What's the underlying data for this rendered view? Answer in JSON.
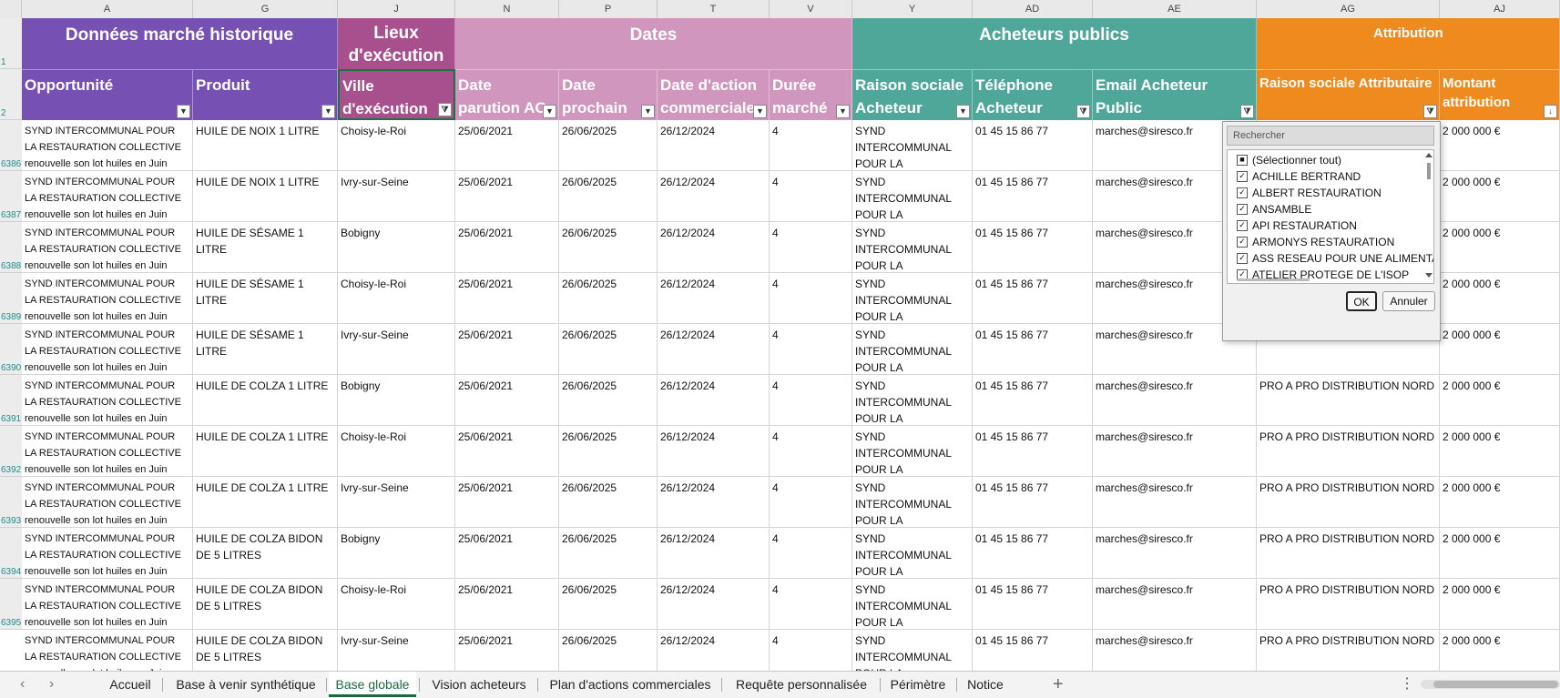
{
  "column_letters": [
    "A",
    "G",
    "J",
    "N",
    "P",
    "T",
    "V",
    "Y",
    "AD",
    "AE",
    "AG",
    "AJ"
  ],
  "row_numbers": [
    "1",
    "2",
    "6386",
    "6387",
    "6388",
    "6389",
    "6390",
    "6391",
    "6392",
    "6393",
    "6394",
    "6395"
  ],
  "groups": {
    "historique": "Données marché historique",
    "lieux": "Lieux d'exécution",
    "dates": "Dates",
    "acheteurs": "Acheteurs publics",
    "attribution": "Attribution"
  },
  "headers": {
    "opportunite": "Opportunité",
    "produit": "Produit",
    "ville": "Ville d'exécution",
    "date_parution": "Date parution AO",
    "date_prochain": "Date prochain AO",
    "date_action": "Date d'action commerciale",
    "duree": "Durée marché",
    "raison_acheteur": "Raison sociale Acheteur",
    "telephone": "Téléphone Acheteur",
    "email": "Email Acheteur Public",
    "raison_attributaire": "Raison sociale Attributaire",
    "montant": "Montant attribution"
  },
  "rows": [
    {
      "opportunite": "SYND INTERCOMMUNAL POUR LA RESTAURATION COLLECTIVE renouvelle son lot huiles en Juin",
      "produit": "HUILE DE NOIX 1 LITRE",
      "ville": "Choisy-le-Roi",
      "parution": "25/06/2021",
      "prochain": "26/06/2025",
      "action": "26/12/2024",
      "duree": "4",
      "acheteur": "SYND INTERCOMMUNAL POUR LA",
      "tel": "01 45 15 86 77",
      "email": "marches@siresco.fr",
      "attributaire": "",
      "montant": "2 000 000 €"
    },
    {
      "opportunite": "SYND INTERCOMMUNAL POUR LA RESTAURATION COLLECTIVE renouvelle son lot huiles en Juin",
      "produit": "HUILE DE NOIX 1 LITRE",
      "ville": "Ivry-sur-Seine",
      "parution": "25/06/2021",
      "prochain": "26/06/2025",
      "action": "26/12/2024",
      "duree": "4",
      "acheteur": "SYND INTERCOMMUNAL POUR LA",
      "tel": "01 45 15 86 77",
      "email": "marches@siresco.fr",
      "attributaire": "",
      "montant": "2 000 000 €"
    },
    {
      "opportunite": "SYND INTERCOMMUNAL POUR LA RESTAURATION COLLECTIVE renouvelle son lot huiles en Juin",
      "produit": "HUILE DE SÉSAME 1 LITRE",
      "ville": "Bobigny",
      "parution": "25/06/2021",
      "prochain": "26/06/2025",
      "action": "26/12/2024",
      "duree": "4",
      "acheteur": "SYND INTERCOMMUNAL POUR LA",
      "tel": "01 45 15 86 77",
      "email": "marches@siresco.fr",
      "attributaire": "",
      "montant": "2 000 000 €"
    },
    {
      "opportunite": "SYND INTERCOMMUNAL POUR LA RESTAURATION COLLECTIVE renouvelle son lot huiles en Juin",
      "produit": "HUILE DE SÉSAME 1 LITRE",
      "ville": "Choisy-le-Roi",
      "parution": "25/06/2021",
      "prochain": "26/06/2025",
      "action": "26/12/2024",
      "duree": "4",
      "acheteur": "SYND INTERCOMMUNAL POUR LA",
      "tel": "01 45 15 86 77",
      "email": "marches@siresco.fr",
      "attributaire": "",
      "montant": "2 000 000 €"
    },
    {
      "opportunite": "SYND INTERCOMMUNAL POUR LA RESTAURATION COLLECTIVE renouvelle son lot huiles en Juin",
      "produit": "HUILE DE SÉSAME 1 LITRE",
      "ville": "Ivry-sur-Seine",
      "parution": "25/06/2021",
      "prochain": "26/06/2025",
      "action": "26/12/2024",
      "duree": "4",
      "acheteur": "SYND INTERCOMMUNAL POUR LA",
      "tel": "01 45 15 86 77",
      "email": "marches@siresco.fr",
      "attributaire": "",
      "montant": "2 000 000 €"
    },
    {
      "opportunite": "SYND INTERCOMMUNAL POUR LA RESTAURATION COLLECTIVE renouvelle son lot huiles en Juin",
      "produit": "HUILE DE COLZA 1 LITRE",
      "ville": "Bobigny",
      "parution": "25/06/2021",
      "prochain": "26/06/2025",
      "action": "26/12/2024",
      "duree": "4",
      "acheteur": "SYND INTERCOMMUNAL POUR LA",
      "tel": "01 45 15 86 77",
      "email": "marches@siresco.fr",
      "attributaire": "PRO A PRO DISTRIBUTION NORD",
      "montant": "2 000 000 €"
    },
    {
      "opportunite": "SYND INTERCOMMUNAL POUR LA RESTAURATION COLLECTIVE renouvelle son lot huiles en Juin",
      "produit": "HUILE DE COLZA 1 LITRE",
      "ville": "Choisy-le-Roi",
      "parution": "25/06/2021",
      "prochain": "26/06/2025",
      "action": "26/12/2024",
      "duree": "4",
      "acheteur": "SYND INTERCOMMUNAL POUR LA",
      "tel": "01 45 15 86 77",
      "email": "marches@siresco.fr",
      "attributaire": "PRO A PRO DISTRIBUTION NORD",
      "montant": "2 000 000 €"
    },
    {
      "opportunite": "SYND INTERCOMMUNAL POUR LA RESTAURATION COLLECTIVE renouvelle son lot huiles en Juin",
      "produit": "HUILE DE COLZA 1 LITRE",
      "ville": "Ivry-sur-Seine",
      "parution": "25/06/2021",
      "prochain": "26/06/2025",
      "action": "26/12/2024",
      "duree": "4",
      "acheteur": "SYND INTERCOMMUNAL POUR LA",
      "tel": "01 45 15 86 77",
      "email": "marches@siresco.fr",
      "attributaire": "PRO A PRO DISTRIBUTION NORD",
      "montant": "2 000 000 €"
    },
    {
      "opportunite": "SYND INTERCOMMUNAL POUR LA RESTAURATION COLLECTIVE renouvelle son lot huiles en Juin",
      "produit": "HUILE DE COLZA BIDON DE 5 LITRES",
      "ville": "Bobigny",
      "parution": "25/06/2021",
      "prochain": "26/06/2025",
      "action": "26/12/2024",
      "duree": "4",
      "acheteur": "SYND INTERCOMMUNAL POUR LA",
      "tel": "01 45 15 86 77",
      "email": "marches@siresco.fr",
      "attributaire": "PRO A PRO DISTRIBUTION NORD",
      "montant": "2 000 000 €"
    },
    {
      "opportunite": "SYND INTERCOMMUNAL POUR LA RESTAURATION COLLECTIVE renouvelle son lot huiles en Juin",
      "produit": "HUILE DE COLZA BIDON DE 5 LITRES",
      "ville": "Choisy-le-Roi",
      "parution": "25/06/2021",
      "prochain": "26/06/2025",
      "action": "26/12/2024",
      "duree": "4",
      "acheteur": "SYND INTERCOMMUNAL POUR LA",
      "tel": "01 45 15 86 77",
      "email": "marches@siresco.fr",
      "attributaire": "PRO A PRO DISTRIBUTION NORD",
      "montant": "2 000 000 €"
    },
    {
      "opportunite": "SYND INTERCOMMUNAL POUR LA RESTAURATION COLLECTIVE renouvelle son lot huiles en Juin",
      "produit": "HUILE DE COLZA BIDON DE 5 LITRES",
      "ville": "Ivry-sur-Seine",
      "parution": "25/06/2021",
      "prochain": "26/06/2025",
      "action": "26/12/2024",
      "duree": "4",
      "acheteur": "SYND INTERCOMMUNAL POUR LA",
      "tel": "01 45 15 86 77",
      "email": "marches@siresco.fr",
      "attributaire": "PRO A PRO DISTRIBUTION NORD",
      "montant": "2 000 000 €"
    }
  ],
  "filter_popup": {
    "search_placeholder": "Rechercher",
    "items": [
      {
        "label": "(Sélectionner tout)",
        "state": "partial"
      },
      {
        "label": "ACHILLE BERTRAND",
        "state": "checked"
      },
      {
        "label": "ALBERT RESTAURATION",
        "state": "checked"
      },
      {
        "label": "ANSAMBLE",
        "state": "checked"
      },
      {
        "label": "API RESTAURATION",
        "state": "checked"
      },
      {
        "label": "ARMONYS RESTAURATION",
        "state": "checked"
      },
      {
        "label": "ASS RESEAU POUR UNE ALIMENTA",
        "state": "checked"
      },
      {
        "label": "ATELIER PROTEGE DE L'ISOP",
        "state": "checked"
      }
    ],
    "ok_label": "OK",
    "cancel_label": "Annuler"
  },
  "tabs": [
    {
      "label": "Accueil",
      "active": false
    },
    {
      "label": "Base à venir synthétique",
      "active": false
    },
    {
      "label": "Base globale",
      "active": true
    },
    {
      "label": "Vision acheteurs",
      "active": false
    },
    {
      "label": "Plan d'actions commerciales",
      "active": false
    },
    {
      "label": "Requête personnalisée",
      "active": false
    },
    {
      "label": "Périmètre",
      "active": false
    },
    {
      "label": "Notice",
      "active": false
    }
  ],
  "icons": {
    "filter_dropdown": "chevron-down-icon",
    "filter_active": "funnel-icon",
    "add_sheet": "plus-icon",
    "prev_sheet": "chevron-left-icon",
    "next_sheet": "chevron-right-icon",
    "more": "vertical-dots-icon"
  },
  "colors": {
    "historique": "#7651b3",
    "lieux": "#a8508d",
    "dates": "#d196bd",
    "acheteurs": "#4fa79a",
    "attribution": "#ef8a1e",
    "active_tab": "#1a6b3c"
  }
}
